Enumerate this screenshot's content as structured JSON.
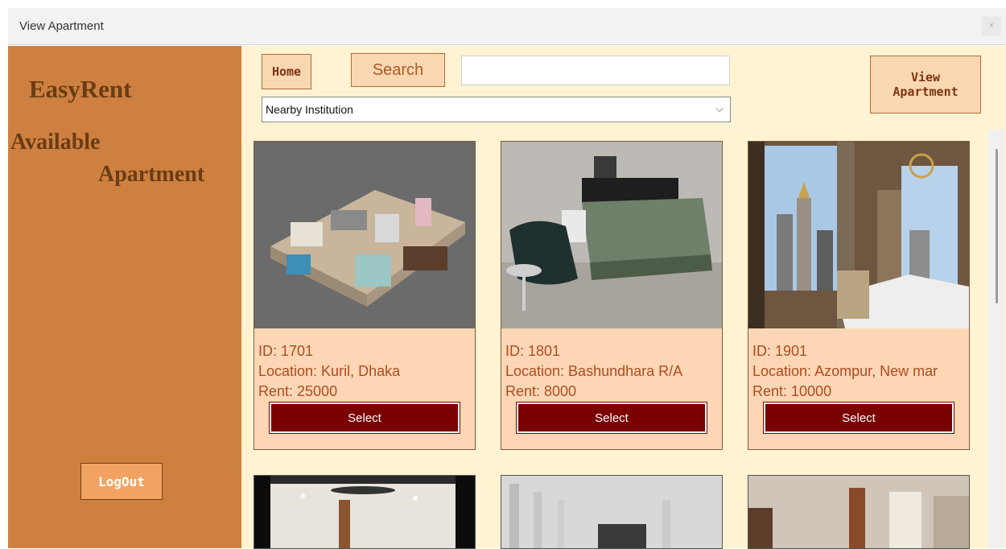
{
  "window": {
    "title": "View Apartment",
    "close": "×"
  },
  "sidebar": {
    "brand": "EasyRent",
    "heading_line1": "Available",
    "heading_line2": "Apartment",
    "logout_label": "LogOut"
  },
  "toolbar": {
    "home_label": "Home",
    "search_label": "Search",
    "search_value": "",
    "view_label_line1": "View",
    "view_label_line2": "Apartment"
  },
  "filter": {
    "selected": "Nearby Institution",
    "arrow": "⌵"
  },
  "cards": [
    {
      "id": "ID: 1701",
      "location": "Location: Kuril, Dhaka",
      "rent": "Rent: 25000",
      "select": "Select"
    },
    {
      "id": "ID: 1801",
      "location": "Location: Bashundhara R/A",
      "rent": "Rent: 8000",
      "select": "Select"
    },
    {
      "id": "ID: 1901",
      "location": "Location: Azompur, New mar",
      "rent": "Rent: 10000",
      "select": "Select"
    }
  ],
  "colors": {
    "sidebar": "#cd8040",
    "main_bg": "#fff3d2",
    "card_bg": "#fdd7b5",
    "select_btn": "#7a0000",
    "brand_text": "#6a3c13"
  }
}
